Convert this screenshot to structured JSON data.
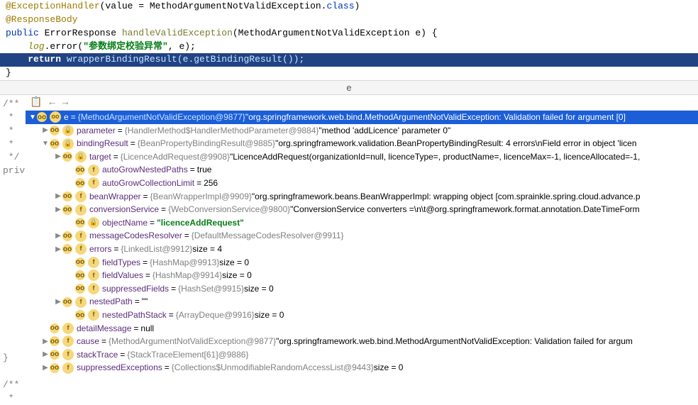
{
  "code": {
    "l1a": "@ExceptionHandler",
    "l1b": "(value = MethodArgumentNotValidException.",
    "l1c": "class",
    "l1d": ")",
    "l2": "@ResponseBody",
    "l3a": "public",
    "l3b": " ErrorResponse ",
    "l3c": "handleValidException",
    "l3d": "(MethodArgumentNotValidException e) {",
    "l4a": "    ",
    "l4b": "log",
    "l4c": ".error(",
    "l4d": "\"参数绑定校验异常\"",
    "l4e": ", e);",
    "l5": "",
    "l6a": "    return ",
    "l6b": "wrapperBindingResult(e.getBindingResult());",
    "l7": "}"
  },
  "varHeader": "e",
  "gutterText": "/**\n *\n *\n *\n */\npriv\n\n\n\n\n\n\n\n\n\n\n\n\n\n}\n\n/**\n *",
  "tree": {
    "root": {
      "name": "e",
      "ref": "{MethodArgumentNotValidException@9877}",
      "val": "\"org.springframework.web.bind.MethodArgumentNotValidException: Validation failed for argument [0]"
    },
    "items": [
      {
        "depth": 1,
        "arrow": "▶",
        "icon": "f",
        "lock": true,
        "name": "parameter",
        "ref": "{HandlerMethod$HandlerMethodParameter@9884}",
        "val": "\"method 'addLicence' parameter 0\""
      },
      {
        "depth": 1,
        "arrow": "▼",
        "icon": "f",
        "lock": true,
        "name": "bindingResult",
        "ref": "{BeanPropertyBindingResult@9885}",
        "val": "\"org.springframework.validation.BeanPropertyBindingResult: 4 errors\\nField error in object 'licen"
      },
      {
        "depth": 2,
        "arrow": "▶",
        "icon": "f",
        "lock": true,
        "name": "target",
        "ref": "{LicenceAddRequest@9908}",
        "val": "\"LicenceAddRequest(organizationId=null, licenceType=, productName=, licenceMax=-1, licenceAllocated=-1,"
      },
      {
        "depth": 3,
        "arrow": "",
        "icon": "f",
        "name": "autoGrowNestedPaths",
        "val": "true"
      },
      {
        "depth": 3,
        "arrow": "",
        "icon": "f",
        "name": "autoGrowCollectionLimit",
        "val": "256"
      },
      {
        "depth": 2,
        "arrow": "▶",
        "icon": "f",
        "name": "beanWrapper",
        "ref": "{BeanWrapperImpl@9909}",
        "val": "\"org.springframework.beans.BeanWrapperImpl: wrapping object [com.sprainkle.spring.cloud.advance.p"
      },
      {
        "depth": 2,
        "arrow": "▶",
        "icon": "f",
        "name": "conversionService",
        "ref": "{WebConversionService@9800}",
        "val": "\"ConversionService converters =\\n\\t@org.springframework.format.annotation.DateTimeForm"
      },
      {
        "depth": 3,
        "arrow": "",
        "icon": "f",
        "lock": true,
        "name": "objectName",
        "green": "\"licenceAddRequest\""
      },
      {
        "depth": 2,
        "arrow": "▶",
        "icon": "f",
        "name": "messageCodesResolver",
        "ref": "{DefaultMessageCodesResolver@9911}"
      },
      {
        "depth": 2,
        "arrow": "▶",
        "icon": "f",
        "name": "errors",
        "ref": "{LinkedList@9912}",
        "val": " size = 4"
      },
      {
        "depth": 3,
        "arrow": "",
        "icon": "f",
        "name": "fieldTypes",
        "ref": "{HashMap@9913}",
        "val": " size = 0"
      },
      {
        "depth": 3,
        "arrow": "",
        "icon": "f",
        "name": "fieldValues",
        "ref": "{HashMap@9914}",
        "val": " size = 0"
      },
      {
        "depth": 3,
        "arrow": "",
        "icon": "f",
        "name": "suppressedFields",
        "ref": "{HashSet@9915}",
        "val": " size = 0"
      },
      {
        "depth": 2,
        "arrow": "▶",
        "icon": "f",
        "name": "nestedPath",
        "val": "\"\""
      },
      {
        "depth": 3,
        "arrow": "",
        "icon": "f",
        "name": "nestedPathStack",
        "ref": "{ArrayDeque@9916}",
        "val": " size = 0"
      },
      {
        "depth": 1,
        "arrow": "",
        "icon": "f",
        "name": "detailMessage",
        "val": "null"
      },
      {
        "depth": 1,
        "arrow": "▶",
        "icon": "f",
        "name": "cause",
        "ref": "{MethodArgumentNotValidException@9877}",
        "val": "\"org.springframework.web.bind.MethodArgumentNotValidException: Validation failed for argum"
      },
      {
        "depth": 1,
        "arrow": "▶",
        "icon": "f",
        "name": "stackTrace",
        "ref": "{StackTraceElement[61]@9886}"
      },
      {
        "depth": 1,
        "arrow": "▶",
        "icon": "f",
        "name": "suppressedExceptions",
        "ref": "{Collections$UnmodifiableRandomAccessList@9443}",
        "val": " size = 0"
      }
    ]
  }
}
